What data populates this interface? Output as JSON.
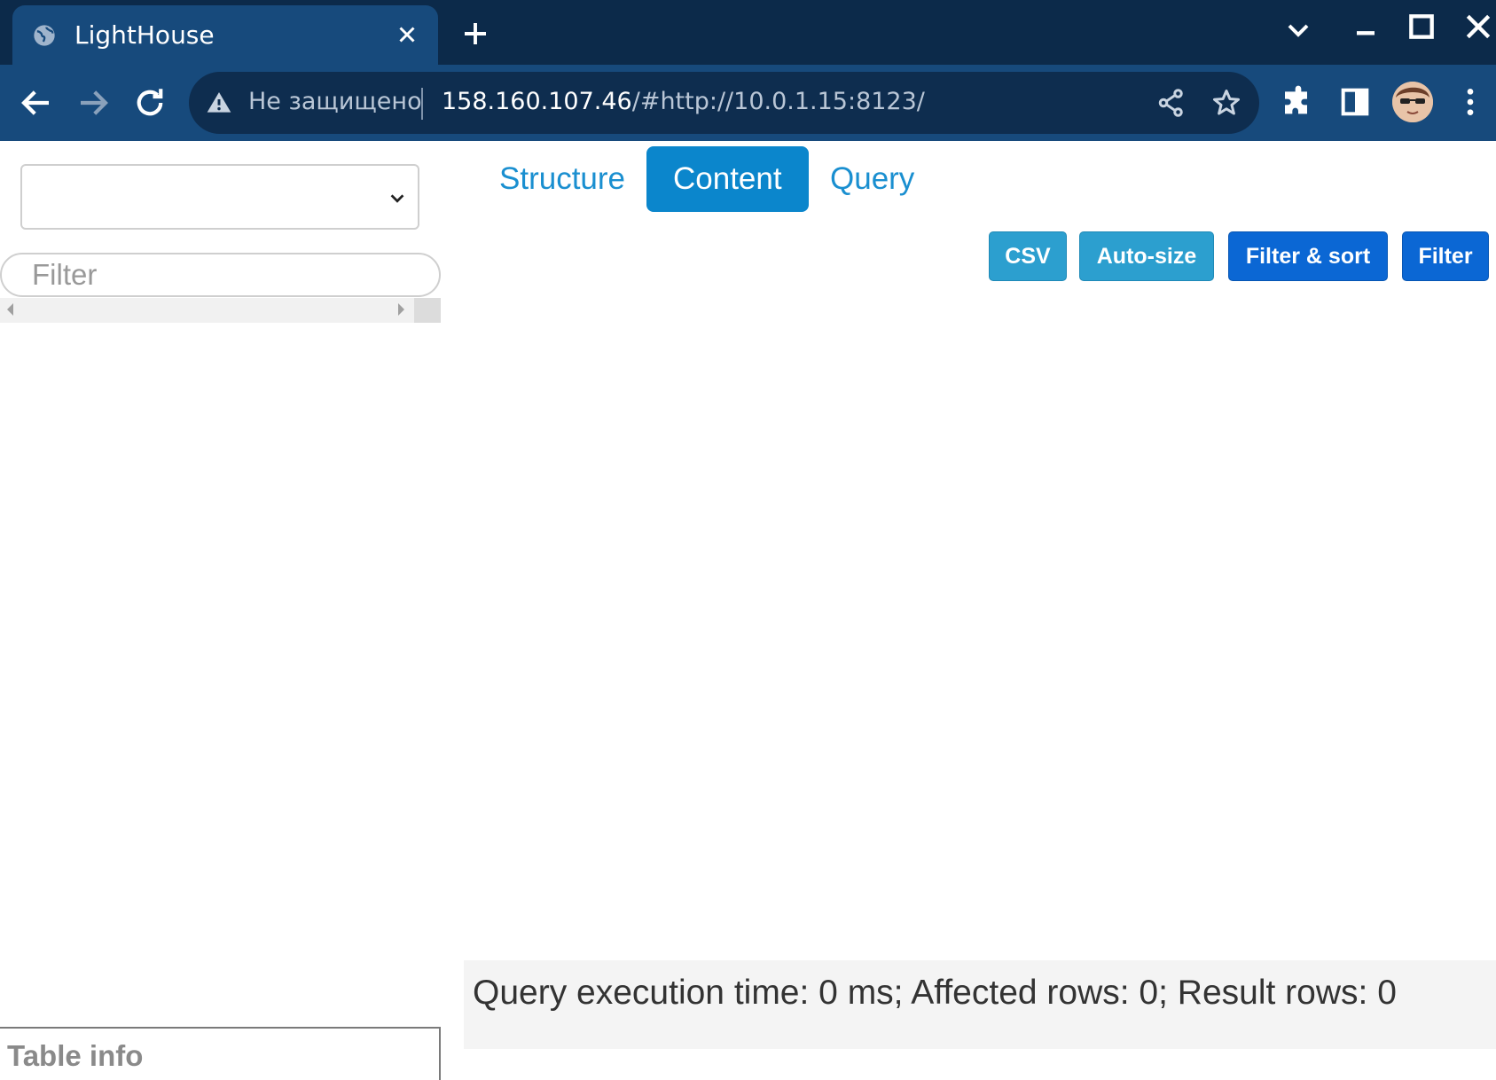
{
  "browser": {
    "tab_title": "LightHouse",
    "insecure_label": "Не защищено",
    "url_host": "158.160.107.46",
    "url_rest": "/#http://10.0.1.15:8123/"
  },
  "sidebar": {
    "database_select_value": "",
    "filter_placeholder": "Filter",
    "table_info_label": "Table info"
  },
  "tabs": [
    {
      "label": "Structure",
      "active": false
    },
    {
      "label": "Content",
      "active": true
    },
    {
      "label": "Query",
      "active": false
    }
  ],
  "toolbar_buttons": {
    "csv": "CSV",
    "autosize": "Auto-size",
    "filter_sort": "Filter & sort",
    "filter": "Filter"
  },
  "status": {
    "text": "Query execution time: 0 ms; Affected rows: 0; Result rows: 0"
  },
  "colors": {
    "accent": "#0b86cc",
    "primary_button": "#0b67d4",
    "info_button": "#2c9fcf",
    "chrome_dark": "#0c2a4a",
    "chrome_toolbar": "#174a7c"
  },
  "icons": [
    "globe-icon",
    "close-icon",
    "plus-icon",
    "chevron-down-icon",
    "minimize-icon",
    "maximize-icon",
    "back-icon",
    "forward-icon",
    "reload-icon",
    "warning-icon",
    "share-icon",
    "star-icon",
    "extensions-icon",
    "side-panel-icon",
    "menu-icon"
  ]
}
